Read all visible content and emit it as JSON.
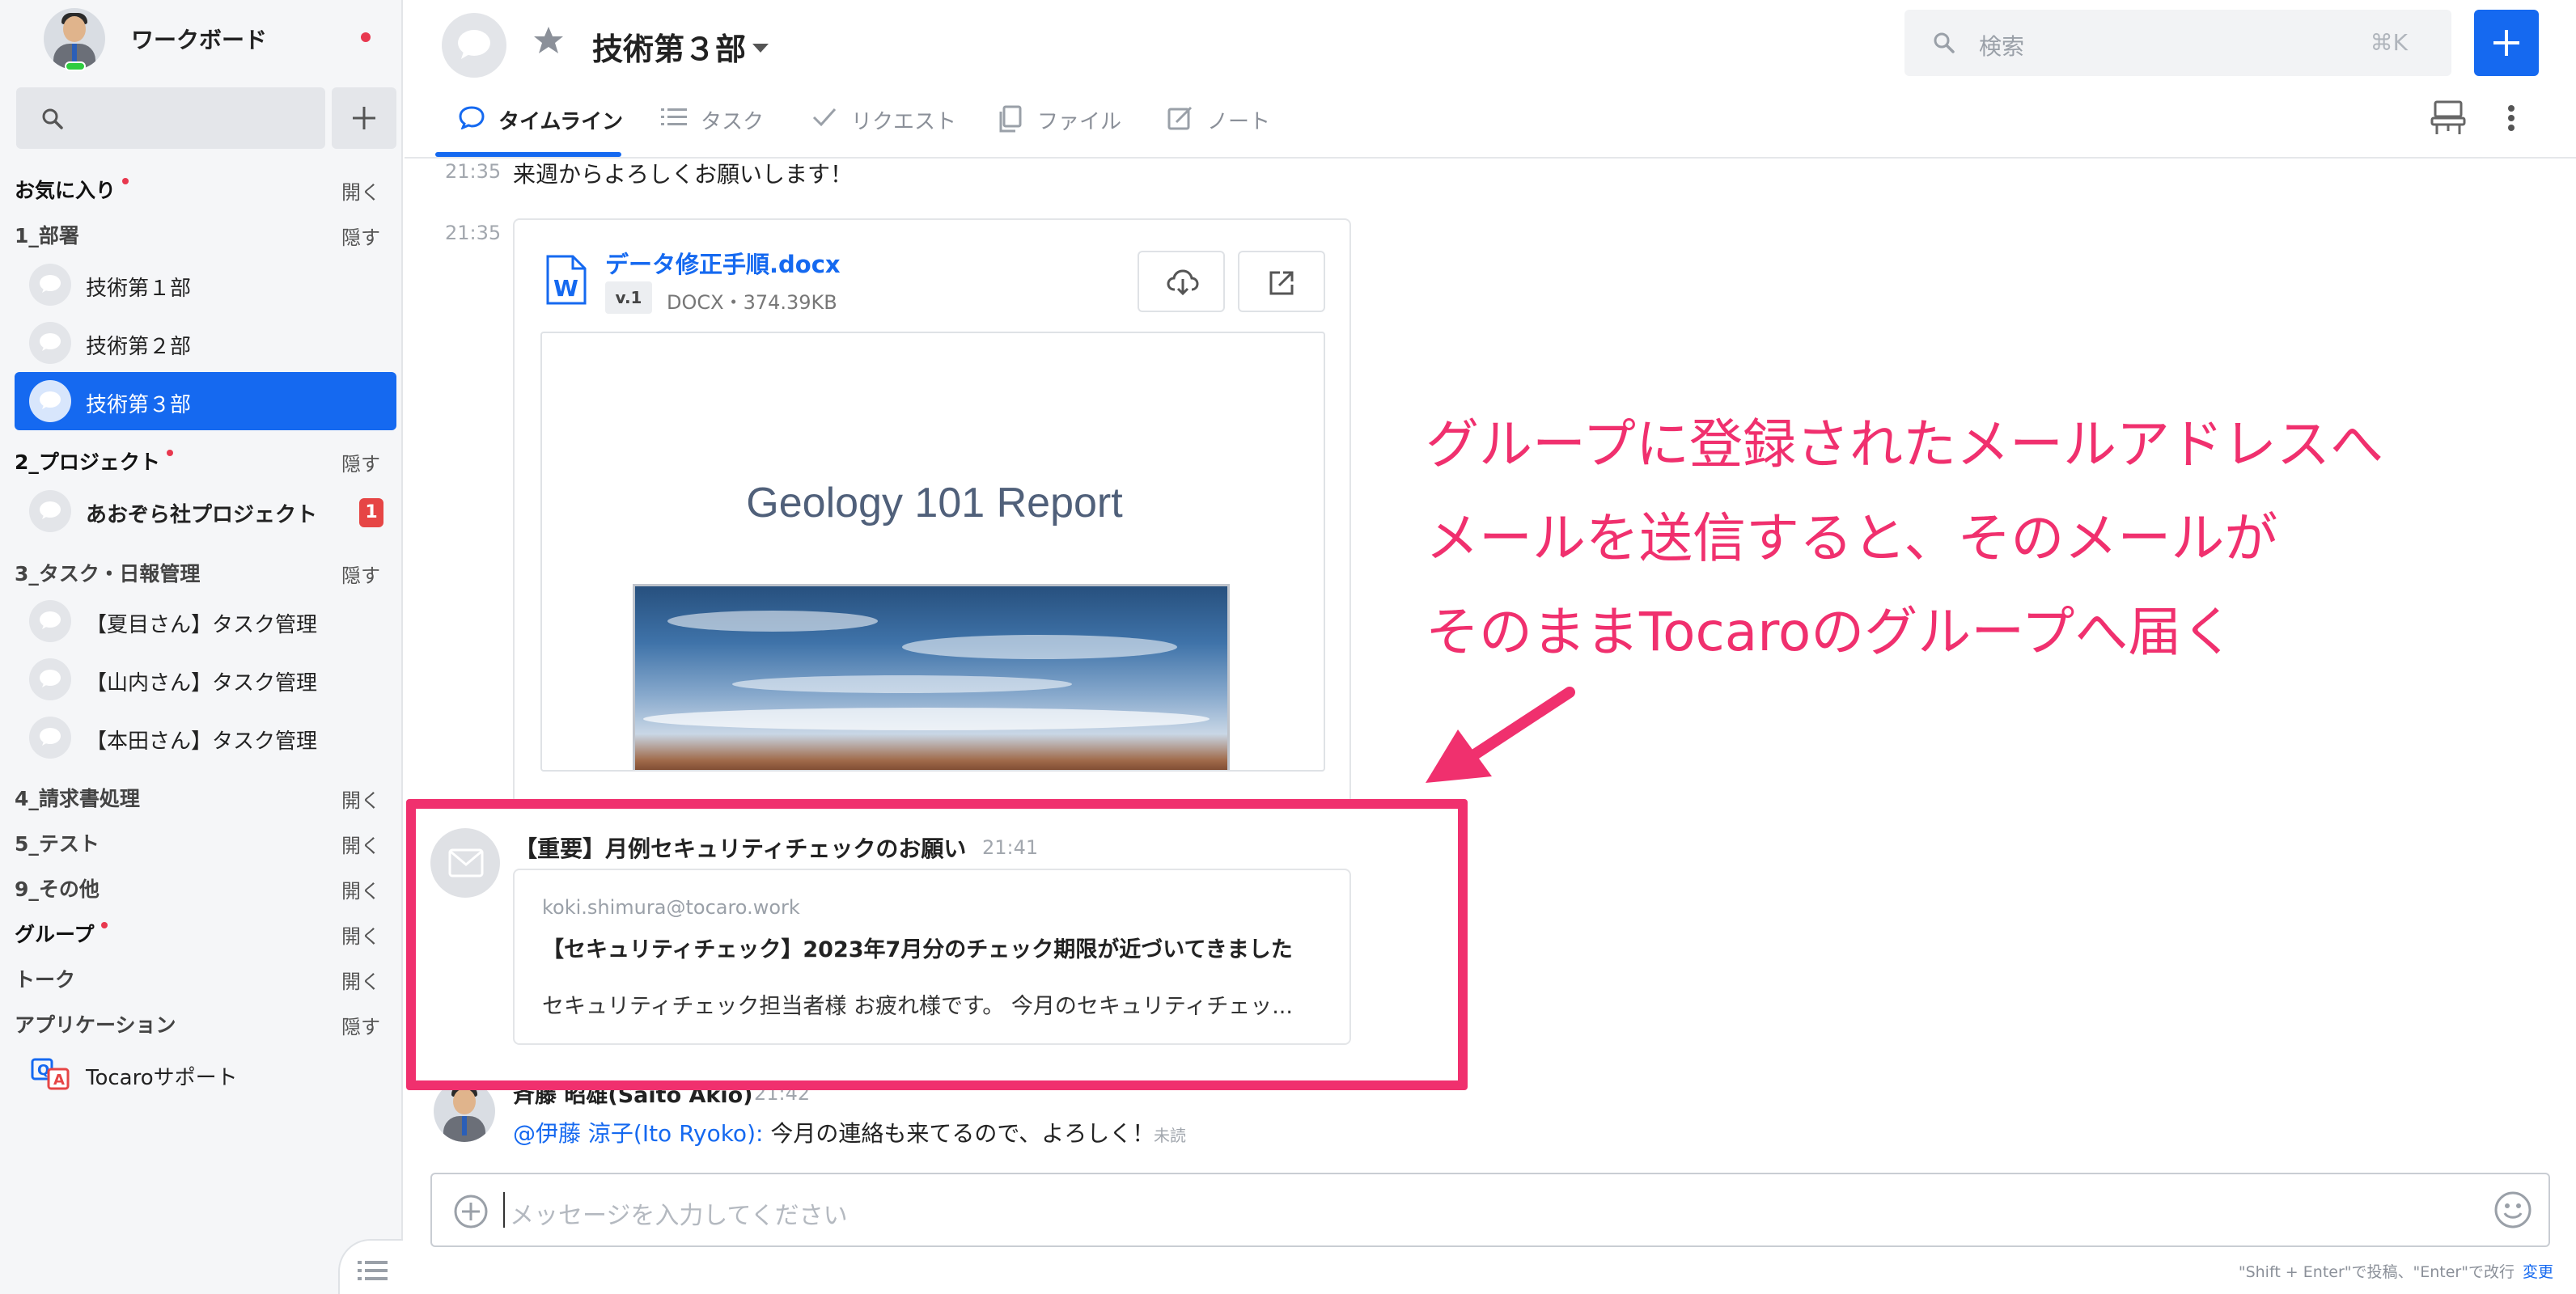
{
  "sidebar": {
    "workspace_name": "ワークボード",
    "sections": {
      "favorites": {
        "title": "お気に入り",
        "action": "開く"
      },
      "dept": {
        "title": "1_部署",
        "action": "隠す"
      },
      "project": {
        "title": "2_プロジェクト",
        "action": "隠す"
      },
      "task": {
        "title": "3_タスク・日報管理",
        "action": "隠す"
      },
      "invoice": {
        "title": "4_請求書処理",
        "action": "開く"
      },
      "test": {
        "title": "5_テスト",
        "action": "開く"
      },
      "other": {
        "title": "9_その他",
        "action": "開く"
      },
      "group": {
        "title": "グループ",
        "action": "開く"
      },
      "talk": {
        "title": "トーク",
        "action": "開く"
      },
      "apps": {
        "title": "アプリケーション",
        "action": "隠す"
      }
    },
    "channels": {
      "tech1": "技術第１部",
      "tech2": "技術第２部",
      "tech3": "技術第３部",
      "aozora": "あおぞら社プロジェクト",
      "aozora_badge": "1",
      "natsume": "【夏目さん】タスク管理",
      "yamauchi": "【山内さん】タスク管理",
      "honda": "【本田さん】タスク管理",
      "support": "Tocaroサポート"
    }
  },
  "header": {
    "room_title": "技術第３部",
    "search_placeholder": "検索",
    "search_shortcut": "⌘K",
    "tabs": [
      "タイムライン",
      "タスク",
      "リクエスト",
      "ファイル",
      "ノート"
    ]
  },
  "timeline": {
    "msg1": {
      "time": "21:35",
      "text": "来週からよろしくお願いします！"
    },
    "file": {
      "time": "21:35",
      "name": "データ修正手順.docx",
      "version": "v.1",
      "meta": "DOCX・374.39KB",
      "preview_title": "Geology 101 Report"
    },
    "mail": {
      "subject": "【重要】月例セキュリティチェックのお願い",
      "time": "21:41",
      "from": "koki.shimura@tocaro.work",
      "headline": "【セキュリティチェック】2023年7月分のチェック期限が近づいてきました",
      "body": "セキュリティチェック担当者様 お疲れ様です。 今月のセキュリティチェッ..."
    },
    "reply": {
      "user": "斉藤 昭雄(Saito Akio)",
      "time": "21:42",
      "mention": "@伊藤 涼子(Ito Ryoko):",
      "text": " 今月の連絡も来てるので、よろしく！",
      "status": "未読"
    }
  },
  "composer": {
    "placeholder": "メッセージを入力してください",
    "hint": "\"Shift + Enter\"で投稿、\"Enter\"で改行",
    "hint_change": "変更"
  },
  "annotation": {
    "lines": [
      "グループに登録されたメールアドレスへ",
      "メールを送信すると、そのメールが",
      "そのままTocaroのグループへ届く"
    ],
    "color": "#f0306e"
  },
  "colors": {
    "accent": "#1569f0",
    "badge": "#e64545",
    "annotation": "#f0306e"
  }
}
